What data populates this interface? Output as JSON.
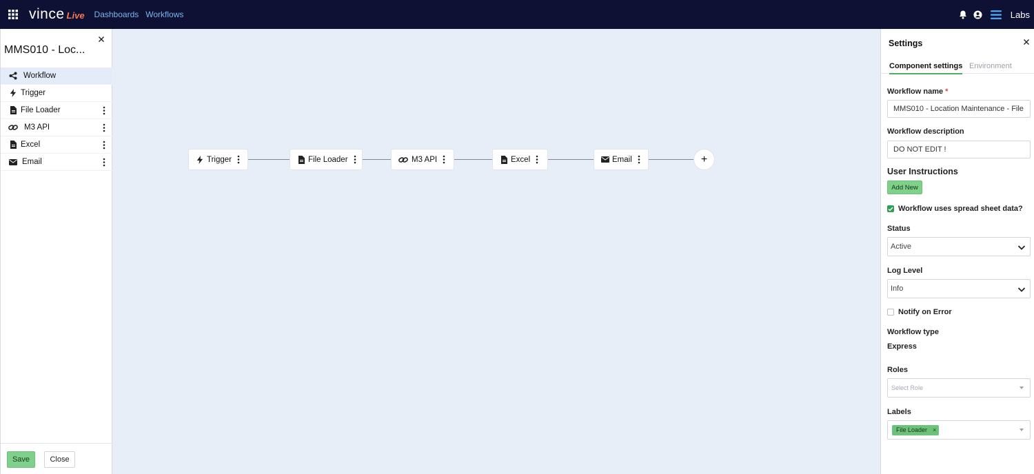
{
  "topbar": {
    "logo_main": "vince",
    "logo_live": "Live",
    "nav": [
      "Dashboards",
      "Workflows"
    ],
    "workspace": "Labs"
  },
  "left_panel": {
    "title": "MMS010 - Loc...",
    "items": [
      {
        "label": "Workflow",
        "icon": "workflow-icon"
      },
      {
        "label": "Trigger",
        "icon": "bolt-icon"
      },
      {
        "label": "File Loader",
        "icon": "file-icon"
      },
      {
        "label": "M3 API",
        "icon": "link-icon"
      },
      {
        "label": "Excel",
        "icon": "file-icon"
      },
      {
        "label": "Email",
        "icon": "envelope-icon"
      }
    ],
    "save_label": "Save",
    "close_label": "Close"
  },
  "canvas": {
    "nodes": [
      {
        "label": "Trigger",
        "icon": "bolt-icon"
      },
      {
        "label": "File Loader",
        "icon": "file-icon"
      },
      {
        "label": "M3 API",
        "icon": "link-icon"
      },
      {
        "label": "Excel",
        "icon": "file-icon"
      },
      {
        "label": "Email",
        "icon": "envelope-icon"
      }
    ],
    "add_label": "+"
  },
  "settings": {
    "title": "Settings",
    "tabs": [
      "Component settings",
      "Environment"
    ],
    "workflow_name_label": "Workflow name",
    "required_mark": "*",
    "workflow_name_value": "MMS010 - Location Maintenance - File",
    "workflow_description_label": "Workflow description",
    "workflow_description_value": "DO NOT EDIT !",
    "user_instructions_label": "User Instructions",
    "add_new_label": "Add New",
    "spreadsheet_label": "Workflow uses spread sheet data?",
    "spreadsheet_checked": true,
    "status_label": "Status",
    "status_value": "Active",
    "log_level_label": "Log Level",
    "log_level_value": "Info",
    "notify_label": "Notify on Error",
    "notify_checked": false,
    "workflow_type_label": "Workflow type",
    "workflow_type_value": "Express",
    "roles_label": "Roles",
    "roles_placeholder": "Select Role",
    "labels_label": "Labels",
    "labels_chips": [
      "File Loader"
    ],
    "chip_remove": "×"
  },
  "colors": {
    "topbar_bg": "#0e1133",
    "nav_link": "#7ab6ee",
    "accent_green": "#7fd08a",
    "canvas_bg": "#e8eef7",
    "active_row": "#e3ecf8"
  }
}
